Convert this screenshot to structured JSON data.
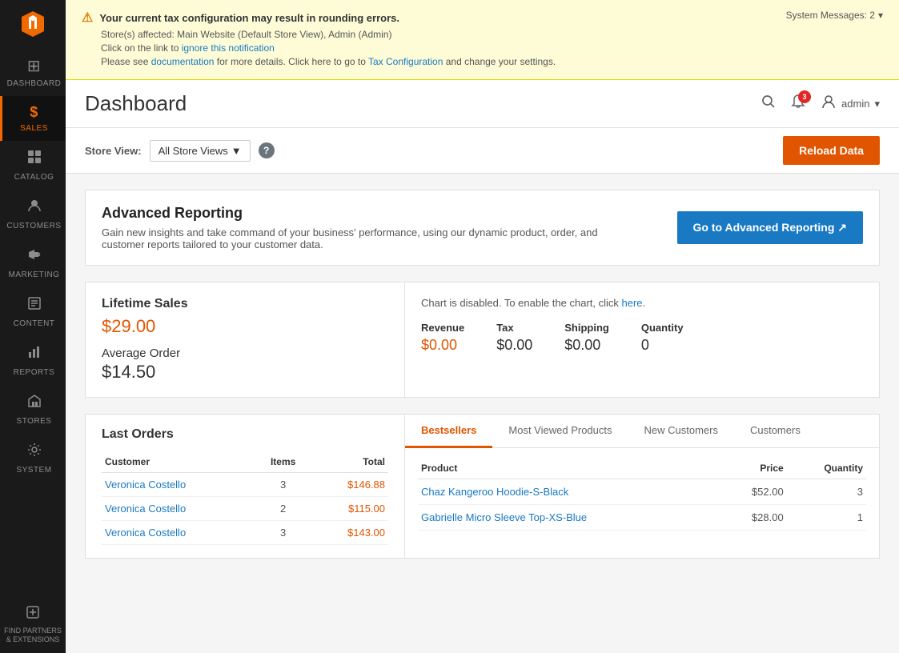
{
  "sidebar": {
    "items": [
      {
        "id": "dashboard",
        "label": "DASHBOARD",
        "icon": "⊞",
        "active": false
      },
      {
        "id": "sales",
        "label": "SALES",
        "icon": "$",
        "active": true
      },
      {
        "id": "catalog",
        "label": "CATALOG",
        "icon": "◫",
        "active": false
      },
      {
        "id": "customers",
        "label": "CUSTOMERS",
        "icon": "👤",
        "active": false
      },
      {
        "id": "marketing",
        "label": "MARKETING",
        "icon": "📣",
        "active": false
      },
      {
        "id": "content",
        "label": "CONTENT",
        "icon": "▦",
        "active": false
      },
      {
        "id": "reports",
        "label": "REPORTS",
        "icon": "📊",
        "active": false
      },
      {
        "id": "stores",
        "label": "STORES",
        "icon": "🏪",
        "active": false
      },
      {
        "id": "system",
        "label": "SYSTEM",
        "icon": "⚙",
        "active": false
      }
    ],
    "bottom": {
      "label": "FIND PARTNERS & EXTENSIONS",
      "icon": "⊕"
    }
  },
  "alert": {
    "title": "Your current tax configuration may result in rounding errors.",
    "stores_affected": "Store(s) affected: Main Website (Default Store View), Admin (Admin)",
    "line1_prefix": "Click on the link to ",
    "ignore_text": "ignore this notification",
    "line2_prefix": "Please see ",
    "documentation_text": "documentation",
    "line2_middle": " for more details. Click here to go to ",
    "tax_config_text": "Tax Configuration",
    "line2_suffix": " and change your settings.",
    "system_messages_label": "System Messages: 2"
  },
  "header": {
    "title": "Dashboard",
    "notification_count": "3",
    "admin_label": "admin",
    "chevron": "▾"
  },
  "store_view": {
    "label": "Store View:",
    "selected": "All Store Views",
    "chevron": "▼",
    "reload_btn": "Reload Data"
  },
  "advanced_reporting": {
    "title": "Advanced Reporting",
    "description": "Gain new insights and take command of your business' performance, using our dynamic product, order, and customer reports tailored to your customer data.",
    "btn_label": "Go to Advanced Reporting ↗"
  },
  "lifetime": {
    "title": "Lifetime Sales",
    "value": "$29.00",
    "average_label": "Average Order",
    "average_value": "$14.50"
  },
  "chart": {
    "disabled_msg_prefix": "Chart is disabled. To enable the chart, click ",
    "disabled_link": "here",
    "disabled_suffix": ".",
    "metrics": [
      {
        "label": "Revenue",
        "value": "$0.00",
        "colored": true
      },
      {
        "label": "Tax",
        "value": "$0.00",
        "colored": false
      },
      {
        "label": "Shipping",
        "value": "$0.00",
        "colored": false
      },
      {
        "label": "Quantity",
        "value": "0",
        "colored": false
      }
    ]
  },
  "last_orders": {
    "title": "Last Orders",
    "columns": [
      "Customer",
      "Items",
      "Total"
    ],
    "rows": [
      {
        "customer": "Veronica Costello",
        "items": "3",
        "total": "$146.88"
      },
      {
        "customer": "Veronica Costello",
        "items": "2",
        "total": "$115.00"
      },
      {
        "customer": "Veronica Costello",
        "items": "3",
        "total": "$143.00"
      }
    ]
  },
  "tabs": {
    "items": [
      {
        "id": "bestsellers",
        "label": "Bestsellers",
        "active": true
      },
      {
        "id": "most-viewed",
        "label": "Most Viewed Products",
        "active": false
      },
      {
        "id": "new-customers",
        "label": "New Customers",
        "active": false
      },
      {
        "id": "customers",
        "label": "Customers",
        "active": false
      }
    ],
    "bestsellers": {
      "columns": [
        "Product",
        "Price",
        "Quantity"
      ],
      "rows": [
        {
          "product": "Chaz Kangeroo Hoodie-S-Black",
          "price": "$52.00",
          "qty": "3"
        },
        {
          "product": "Gabrielle Micro Sleeve Top-XS-Blue",
          "price": "$28.00",
          "qty": "1"
        }
      ]
    }
  }
}
